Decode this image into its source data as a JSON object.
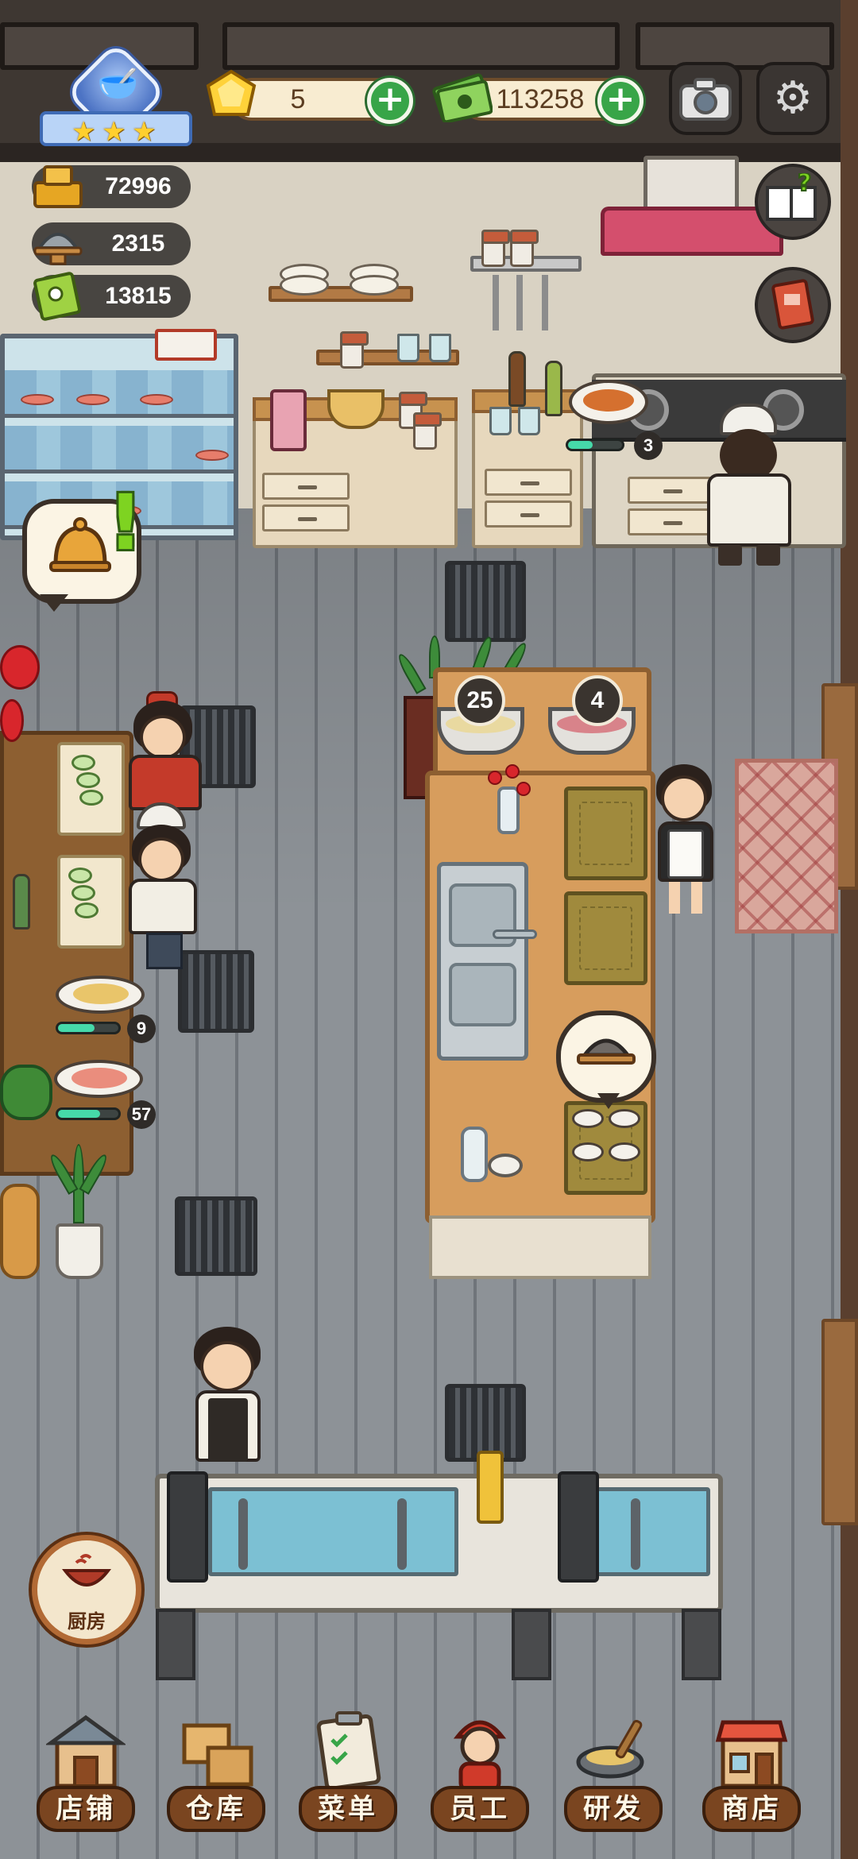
{
  "hud": {
    "restaurant_level_stars": 3,
    "gems": "5",
    "cash": "113258",
    "stats": [
      {
        "icon": "cash-register-icon",
        "value": "72996"
      },
      {
        "icon": "serving-tray-icon",
        "value": "2315"
      },
      {
        "icon": "menu-book-icon",
        "value": "13815"
      }
    ]
  },
  "buttons": {
    "add_gems": "+",
    "add_cash": "+",
    "camera": "camera-icon",
    "settings": "gear-icon",
    "recipe_book": "book-question-icon",
    "journal": "journal-icon",
    "kitchen_label": "厨房"
  },
  "kitchen": {
    "stove_dish_qty": "3",
    "stove_progress": 0.45,
    "hotpot_left_count": "25",
    "hotpot_right_count": "4",
    "prep_dish_1_qty": "9",
    "prep_dish_1_progress": 0.6,
    "prep_dish_2_qty": "57",
    "prep_dish_2_progress": 0.7
  },
  "nav": [
    {
      "label": "店铺",
      "icon": "shop-building-icon"
    },
    {
      "label": "仓库",
      "icon": "warehouse-boxes-icon"
    },
    {
      "label": "菜单",
      "icon": "menu-clipboard-icon"
    },
    {
      "label": "员工",
      "icon": "staff-icon"
    },
    {
      "label": "研发",
      "icon": "research-wok-icon"
    },
    {
      "label": "商店",
      "icon": "store-icon"
    }
  ],
  "colors": {
    "plus_green": "#38a548",
    "progress_teal": "#46d9a9",
    "nav_brown": "#7a4520"
  }
}
